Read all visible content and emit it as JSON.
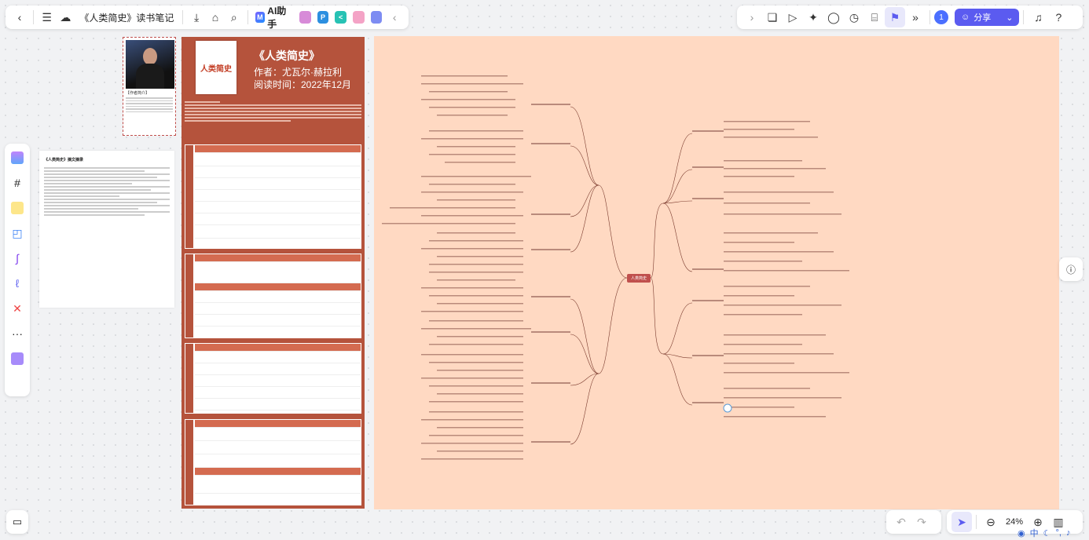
{
  "header": {
    "doc_title": "《人类简史》读书笔记",
    "ai_label": "AI助手",
    "share_label": "分享",
    "user_initial": "1"
  },
  "icons": {
    "back": "chevron-left-icon",
    "menu": "menu-icon",
    "cloud": "cloud-icon",
    "download": "download-icon",
    "tag": "tag-icon",
    "search": "search-icon"
  },
  "left_page": {
    "title": "《人类简史》摘文摘录"
  },
  "author": {
    "label": "【作者简介】"
  },
  "sheet": {
    "title": "《人类简史》",
    "author_line": "作者：尤瓦尔·赫拉利",
    "date_line": "阅读时间：2022年12月",
    "book_cover_text": "人类简史"
  },
  "mindmap": {
    "center": "人类简史"
  },
  "bottom": {
    "zoom": "24%"
  },
  "ime": {
    "lang": "中"
  },
  "colors": {
    "accent": "#5b5bf0",
    "sheet": "#b5533c",
    "mindmap_bg": "#ffd9c2",
    "center_node": "#c0504d"
  }
}
